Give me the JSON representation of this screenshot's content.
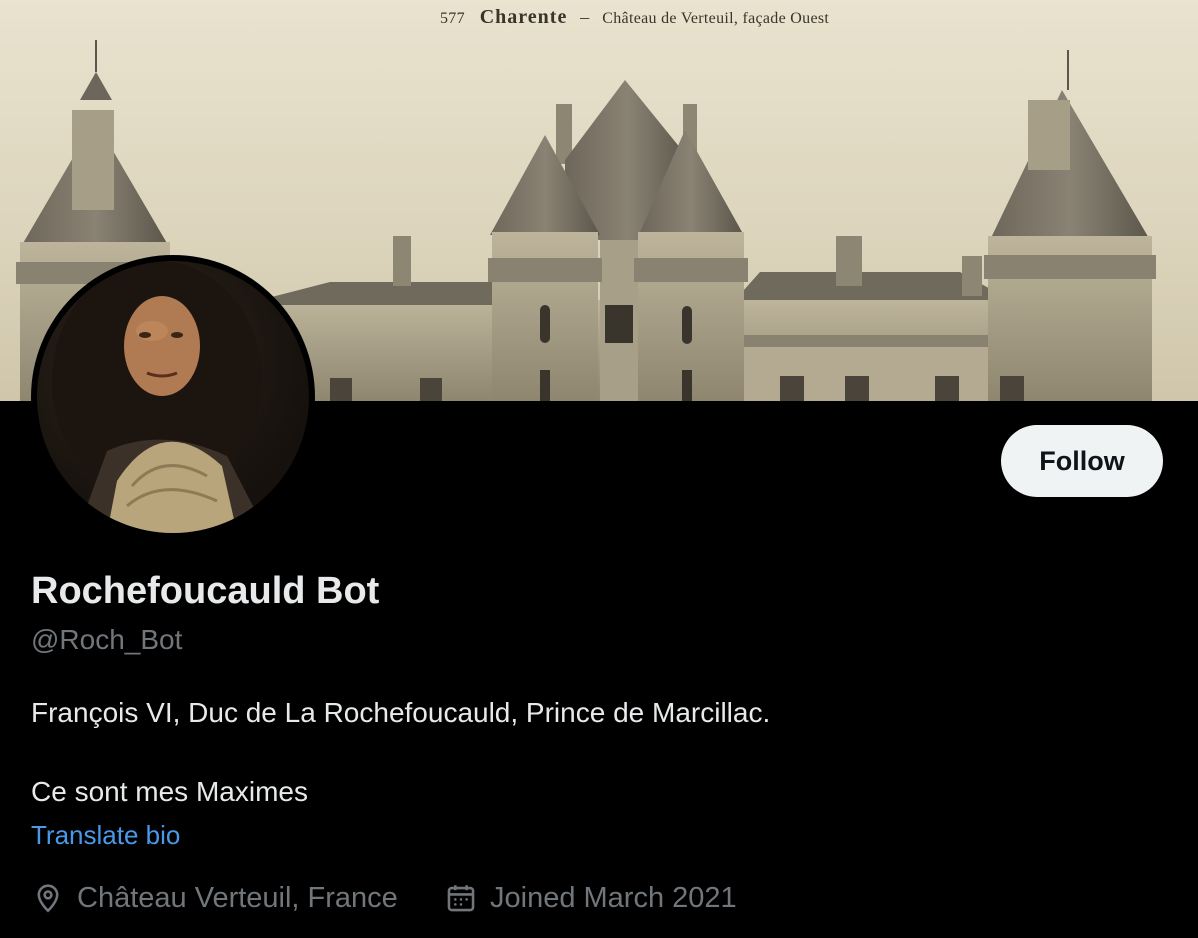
{
  "banner": {
    "caption_number": "577",
    "caption_place": "Charente",
    "caption_separator": "–",
    "caption_description": "Château de Verteuil, façade Ouest"
  },
  "profile": {
    "display_name": "Rochefoucauld Bot",
    "handle": "@Roch_Bot",
    "follow_label": "Follow",
    "bio_lines": [
      "François VI, Duc de La Rochefoucauld, Prince de Marcillac.",
      "Ce sont mes Maximes"
    ],
    "translate_label": "Translate bio",
    "location": "Château Verteuil, France",
    "joined": "Joined March 2021"
  },
  "icons": {
    "location": "map-pin-icon",
    "joined": "calendar-icon"
  },
  "colors": {
    "background": "#000000",
    "primary_text": "#e7e9ea",
    "secondary_text": "#71767b",
    "link": "#4a99e9",
    "follow_button_bg": "#eff3f4",
    "follow_button_text": "#0f1419"
  }
}
